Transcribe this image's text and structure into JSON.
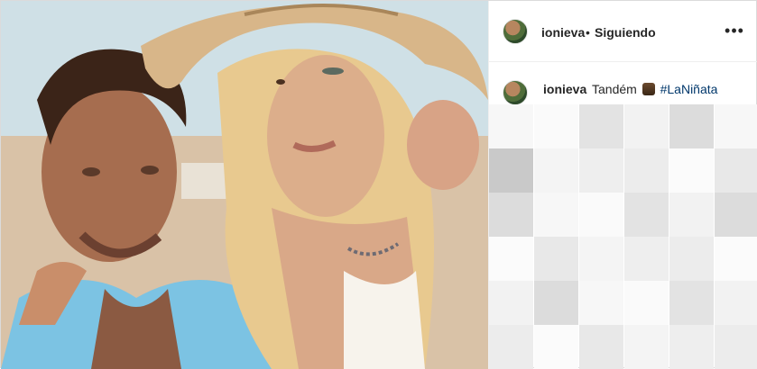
{
  "header": {
    "username": "ionieva",
    "separator": "•",
    "follow_status": "Siguiendo",
    "more_icon": "more-options-icon"
  },
  "comment": {
    "username": "ionieva",
    "text": "Tandém",
    "emoji": "two-people-emoji",
    "hashtag": "#LaNiñata"
  },
  "colors": {
    "text": "#262626",
    "hashtag": "#00376b",
    "border": "#dbdbdb"
  }
}
